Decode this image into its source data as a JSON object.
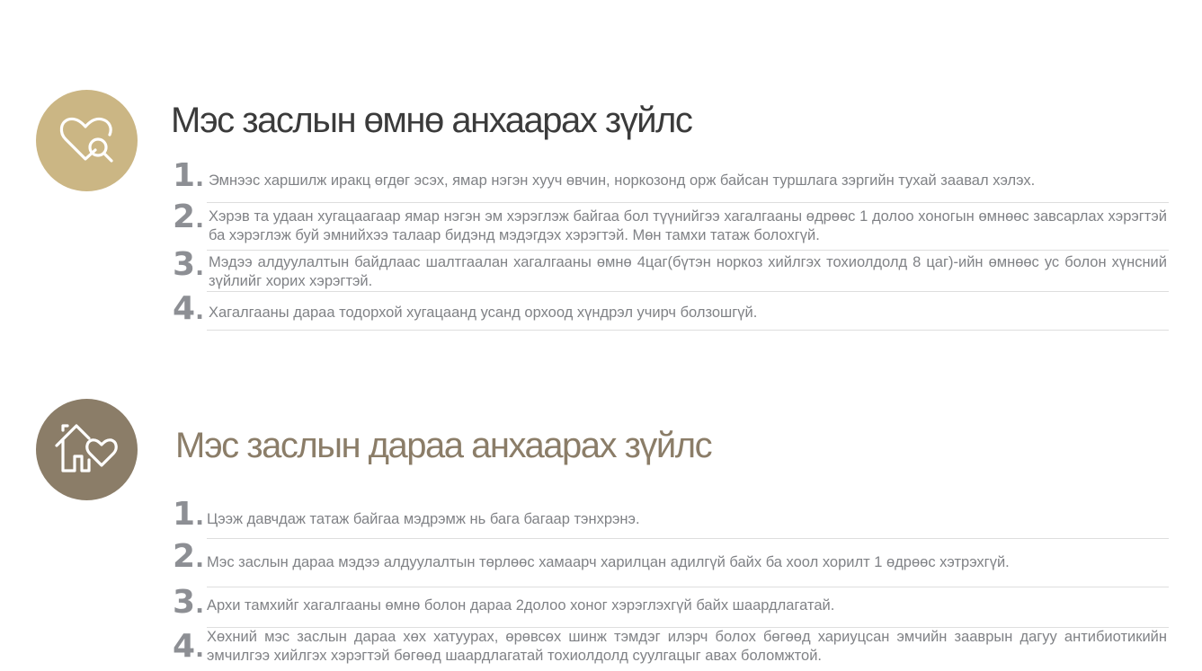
{
  "sections": [
    {
      "title": "Мэс заслын өмнө анхаарах зүйлс",
      "icon": "heart-magnifier-icon",
      "circle_color": "#cbb684",
      "title_color": "#3b3b3b",
      "items": [
        {
          "num": "1",
          "text": "Эмнээс харшилж иракц өгдөг эсэх, ямар нэгэн хууч өвчин, норкозонд орж байсан туршлага зэргийн тухай заавал хэлэх."
        },
        {
          "num": "2",
          "text": "Хэрэв та удаан хугацаагаар ямар нэгэн эм хэрэглэж байгаа бол түүнийгээ хагалгааны өдрөөс 1 долоо хоногын өмнөөс завсарлах хэрэгтэй ба хэрэглэж буй эмнийхээ талаар бидэнд мэдэгдэх хэрэгтэй. Мөн тамхи татаж болохгүй."
        },
        {
          "num": "3",
          "text": "Мэдээ алдуулалтын байдлаас шалтгаалан хагалгааны өмнө 4цаг(бүтэн норкоз хийлгэх тохиолдолд 8 цаг)-ийн өмнөөс ус болон хүнсний зүйлийг хорих хэрэгтэй."
        },
        {
          "num": "4",
          "text": "Хагалгааны дараа тодорхой хугацаанд усанд орхоод хүндрэл учирч болзошгүй."
        }
      ]
    },
    {
      "title": "Мэс заслын дараа анхаарах зүйлс",
      "icon": "house-heart-icon",
      "circle_color": "#8b7d68",
      "title_color": "#8b7d68",
      "items": [
        {
          "num": "1",
          "text": "Цээж давчдаж татаж байгаа мэдрэмж нь бага багаар тэнхрэнэ."
        },
        {
          "num": "2",
          "text": "Мэс заслын дараа мэдээ алдуулалтын төрлөөс хамаарч харилцан адилгүй байх ба хоол хорилт 1 өдрөөс хэтрэхгүй."
        },
        {
          "num": "3",
          "text": "Архи тамхийг хагалгааны өмнө болон дараа 2долоо хоног хэрэглэхгүй байх шаардлагатай."
        },
        {
          "num": "4",
          "text": "Хөхний мэс заслын дараа хөх хатуурах, өрөвсөх шинж тэмдэг илэрч болох бөгөөд хариуцсан эмчийн зааврын дагуу антибиотикийн эмчилгээ хийлгэх хэрэгтэй бөгөөд шаардлагатай тохиолдолд суулгацыг авах боломжтой."
        }
      ]
    }
  ]
}
